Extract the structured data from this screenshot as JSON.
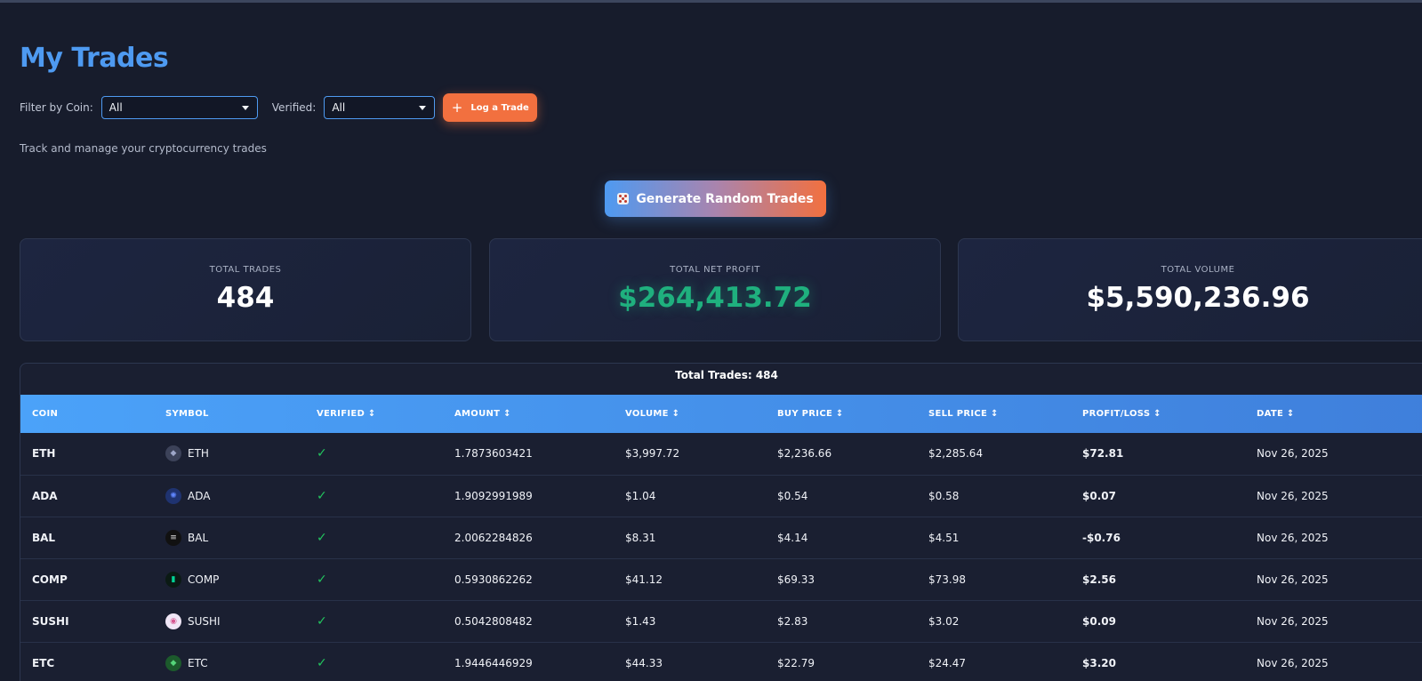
{
  "page": {
    "title": "My Trades",
    "subtitle": "Track and manage your cryptocurrency trades"
  },
  "filters": {
    "coin_label": "Filter by Coin:",
    "coin_value": "All",
    "verified_label": "Verified:",
    "verified_value": "All",
    "log_trade_label": "Log a Trade"
  },
  "generate_button": {
    "label": "Generate Random Trades"
  },
  "stats": [
    {
      "label": "TOTAL TRADES",
      "value": "484"
    },
    {
      "label": "TOTAL NET PROFIT",
      "value": "$264,413.72"
    },
    {
      "label": "TOTAL VOLUME",
      "value": "$5,590,236.96"
    }
  ],
  "table": {
    "caption": "Total Trades: 484",
    "headers": [
      "COIN",
      "SYMBOL",
      "VERIFIED ↕",
      "AMOUNT ↕",
      "VOLUME ↕",
      "BUY PRICE ↕",
      "SELL PRICE ↕",
      "PROFIT/LOSS ↕",
      "DATE ↕"
    ],
    "rows": [
      {
        "coin": "ETH",
        "symbol": "ETH",
        "icon": "ethereum-icon",
        "verified": "✓",
        "amount": "1.7873603421",
        "volume": "$3,997.72",
        "buy": "$2,236.66",
        "sell": "$2,285.64",
        "pl": "$72.81",
        "date": "Nov 26, 2025"
      },
      {
        "coin": "ADA",
        "symbol": "ADA",
        "icon": "cardano-icon",
        "verified": "✓",
        "amount": "1.9092991989",
        "volume": "$1.04",
        "buy": "$0.54",
        "sell": "$0.58",
        "pl": "$0.07",
        "date": "Nov 26, 2025"
      },
      {
        "coin": "BAL",
        "symbol": "BAL",
        "icon": "balancer-icon",
        "verified": "✓",
        "amount": "2.0062284826",
        "volume": "$8.31",
        "buy": "$4.14",
        "sell": "$4.51",
        "pl": "-$0.76",
        "date": "Nov 26, 2025"
      },
      {
        "coin": "COMP",
        "symbol": "COMP",
        "icon": "compound-icon",
        "verified": "✓",
        "amount": "0.5930862262",
        "volume": "$41.12",
        "buy": "$69.33",
        "sell": "$73.98",
        "pl": "$2.56",
        "date": "Nov 26, 2025"
      },
      {
        "coin": "SUSHI",
        "symbol": "SUSHI",
        "icon": "sushi-icon",
        "verified": "✓",
        "amount": "0.5042808482",
        "volume": "$1.43",
        "buy": "$2.83",
        "sell": "$3.02",
        "pl": "$0.09",
        "date": "Nov 26, 2025"
      },
      {
        "coin": "ETC",
        "symbol": "ETC",
        "icon": "ethereum-classic-icon",
        "verified": "✓",
        "amount": "1.9446446929",
        "volume": "$44.33",
        "buy": "$22.79",
        "sell": "$24.47",
        "pl": "$3.20",
        "date": "Nov 26, 2025"
      }
    ]
  },
  "colors": {
    "background": "#171c2c",
    "accent_blue": "#4e9af1",
    "accent_orange": "#f2703f",
    "profit_green": "#1fb07e",
    "verified_green": "#22c55e"
  }
}
